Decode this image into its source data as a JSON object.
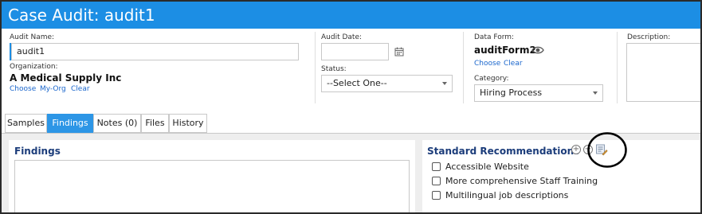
{
  "window": {
    "title": "Case Audit: audit1"
  },
  "audit_name": {
    "label": "Audit Name:",
    "value": "audit1"
  },
  "organization": {
    "label": "Organization:",
    "value": "A Medical Supply Inc",
    "links": [
      "Choose",
      "My-Org",
      "Clear"
    ]
  },
  "audit_date": {
    "label": "Audit Date:",
    "value": ""
  },
  "status": {
    "label": "Status:",
    "selected": "--Select One--"
  },
  "data_form": {
    "label": "Data Form:",
    "value": "auditForm2",
    "links": [
      "Choose",
      "Clear"
    ]
  },
  "category": {
    "label": "Category:",
    "selected": "Hiring Process"
  },
  "description": {
    "label": "Description:"
  },
  "tabs": [
    {
      "label": "Samples",
      "active": false
    },
    {
      "label": "Findings",
      "active": true
    },
    {
      "label": "Notes (0)",
      "active": false
    },
    {
      "label": "Files",
      "active": false
    },
    {
      "label": "History",
      "active": false
    }
  ],
  "findings": {
    "title": "Findings"
  },
  "recommendations": {
    "title": "Standard Recommendations",
    "items": [
      {
        "label": "Accessible Website",
        "checked": false
      },
      {
        "label": "More comprehensive Staff Training",
        "checked": false
      },
      {
        "label": "Multilingual job descriptions",
        "checked": false
      }
    ]
  },
  "colors": {
    "titlebar": "#1c8ee4",
    "active_tab": "#2d96e6",
    "link": "#1a66cc",
    "section_title": "#1b3c7a"
  },
  "icons": [
    "calendar-icon",
    "eye-icon",
    "add-circle-icon",
    "remove-circle-icon",
    "edit-list-icon"
  ]
}
